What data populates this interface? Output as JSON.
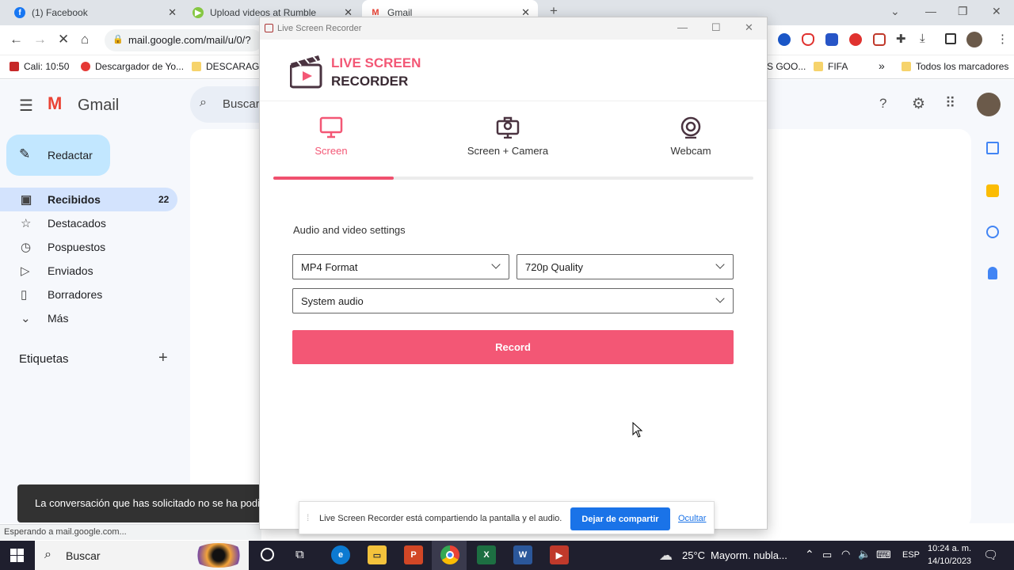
{
  "browser": {
    "tabs": [
      {
        "title": "(1) Facebook",
        "close": "✕"
      },
      {
        "title": "Upload videos at Rumble",
        "close": "✕"
      },
      {
        "title": "Gmail",
        "close": "✕"
      }
    ],
    "new_tab": "+",
    "url": "mail.google.com/mail/u/0/?",
    "bookmarks": [
      "Cali: 10:50",
      "Descargador de Yo...",
      "DESCARAGA",
      "S GOO...",
      "FIFA",
      "Todos los marcadores"
    ],
    "bookmark_more": "»"
  },
  "gmail": {
    "brand": "Gmail",
    "search_placeholder": "Buscar",
    "compose": "Redactar",
    "nav": [
      {
        "label": "Recibidos",
        "count": "22"
      },
      {
        "label": "Destacados"
      },
      {
        "label": "Pospuestos"
      },
      {
        "label": "Enviados"
      },
      {
        "label": "Borradores"
      },
      {
        "label": "Más"
      }
    ],
    "labels_heading": "Etiquetas",
    "labels_add": "+",
    "toast": "La conversación que has solicitado no se ha podido cargar.",
    "status": "Esperando a mail.google.com..."
  },
  "recorder": {
    "window_title": "Live Screen Recorder",
    "logo_line1": "LIVE SCREEN",
    "logo_line2": "RECORDER",
    "modes": [
      "Screen",
      "Screen + Camera",
      "Webcam"
    ],
    "active_mode_progress": 0.25,
    "settings_heading": "Audio and video settings",
    "format": "MP4 Format",
    "quality": "720p Quality",
    "audio": "System audio",
    "record": "Record",
    "accent": "#f35775"
  },
  "sharebar": {
    "message": "Live Screen Recorder está compartiendo la pantalla y el audio.",
    "stop": "Dejar de compartir",
    "hide": "Ocultar"
  },
  "taskbar": {
    "search": "Buscar",
    "weather_temp": "25°C",
    "weather_text": "Mayorm. nubla...",
    "lang": "ESP",
    "time": "10:24 a. m.",
    "date": "14/10/2023"
  }
}
